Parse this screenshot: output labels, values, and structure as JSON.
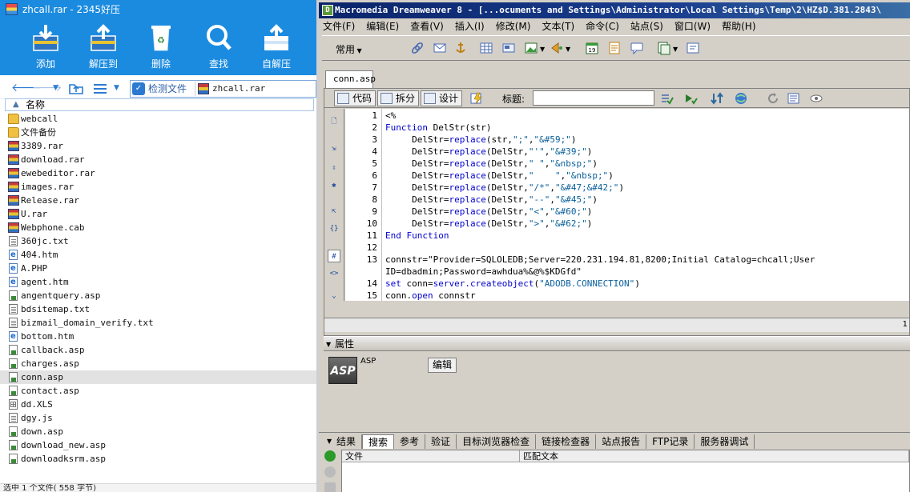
{
  "archive": {
    "title": "zhcall.rar - 2345好压",
    "toolbar": [
      "添加",
      "解压到",
      "删除",
      "查找",
      "自解压"
    ],
    "scan_label": "检测文件",
    "path": "zhcall.rar",
    "column_name": "名称",
    "files": [
      {
        "name": "webcall",
        "type": "folder"
      },
      {
        "name": "文件备份",
        "type": "folder"
      },
      {
        "name": "3389.rar",
        "type": "rar"
      },
      {
        "name": "download.rar",
        "type": "rar"
      },
      {
        "name": "ewebeditor.rar",
        "type": "rar"
      },
      {
        "name": "images.rar",
        "type": "rar"
      },
      {
        "name": "Release.rar",
        "type": "rar"
      },
      {
        "name": "U.rar",
        "type": "rar"
      },
      {
        "name": "Webphone.cab",
        "type": "cab"
      },
      {
        "name": "360jc.txt",
        "type": "txt"
      },
      {
        "name": "404.htm",
        "type": "htm"
      },
      {
        "name": "A.PHP",
        "type": "htm"
      },
      {
        "name": "agent.htm",
        "type": "htm"
      },
      {
        "name": "angentquery.asp",
        "type": "asp"
      },
      {
        "name": "bdsitemap.txt",
        "type": "txt"
      },
      {
        "name": "bizmail_domain_verify.txt",
        "type": "txt"
      },
      {
        "name": "bottom.htm",
        "type": "htm"
      },
      {
        "name": "callback.asp",
        "type": "asp"
      },
      {
        "name": "charges.asp",
        "type": "asp"
      },
      {
        "name": "conn.asp",
        "type": "asp",
        "selected": true
      },
      {
        "name": "contact.asp",
        "type": "asp"
      },
      {
        "name": "dd.XLS",
        "type": "xls"
      },
      {
        "name": "dgy.js",
        "type": "txt"
      },
      {
        "name": "down.asp",
        "type": "asp"
      },
      {
        "name": "download_new.asp",
        "type": "asp"
      },
      {
        "name": "downloadksrm.asp",
        "type": "asp"
      }
    ],
    "status": "选中 1 个文件( 558 字节)"
  },
  "dreamweaver": {
    "title": "Macromedia Dreamweaver 8 - [...ocuments and Settings\\Administrator\\Local Settings\\Temp\\2\\HZ$D.381.2843\\",
    "menu": [
      "文件(F)",
      "编辑(E)",
      "查看(V)",
      "插入(I)",
      "修改(M)",
      "文本(T)",
      "命令(C)",
      "站点(S)",
      "窗口(W)",
      "帮助(H)"
    ],
    "insert_category": "常用",
    "doc_tab": "conn.asp",
    "views": [
      "代码",
      "拆分",
      "设计"
    ],
    "title_label": "标题:",
    "code_lines": [
      {
        "n": "1",
        "text": "<%"
      },
      {
        "n": "2",
        "text": "Function DelStr(str)"
      },
      {
        "n": "3",
        "text": "     DelStr=replace(str,\";\",\"&#59;\")"
      },
      {
        "n": "4",
        "text": "     DelStr=replace(DelStr,\"'\",\"&#39;\")"
      },
      {
        "n": "5",
        "text": "     DelStr=replace(DelStr,\" \",\"&nbsp;\")"
      },
      {
        "n": "6",
        "text": "     DelStr=replace(DelStr,\"    \",\"&nbsp;\")"
      },
      {
        "n": "7",
        "text": "     DelStr=replace(DelStr,\"/*\",\"&#47;&#42;\")"
      },
      {
        "n": "8",
        "text": "     DelStr=replace(DelStr,\"--\",\"&#45;\")"
      },
      {
        "n": "9",
        "text": "     DelStr=replace(DelStr,\"<\",\"&#60;\")"
      },
      {
        "n": "10",
        "text": "     DelStr=replace(DelStr,\">\",\"&#62;\")"
      },
      {
        "n": "11",
        "text": "End Function"
      },
      {
        "n": "12",
        "text": ""
      },
      {
        "n": "13",
        "text": "connstr=\"Provider=SQLOLEDB;Server=220.231.194.81,8200;Initial Catalog=chcall;User"
      },
      {
        "n": "",
        "text": "ID=dbadmin;Password=awhdua%&@%$KDGfd\""
      },
      {
        "n": "14",
        "text": "set conn=server.createobject(\"ADODB.CONNECTION\")"
      },
      {
        "n": "15",
        "text": "conn.open connstr"
      }
    ],
    "hscroll_value": "1",
    "properties_label": "属性",
    "file_type": "ASP",
    "edit_button": "编辑",
    "result_tabs": [
      "结果",
      "搜索",
      "参考",
      "验证",
      "目标浏览器检查",
      "链接检查器",
      "站点报告",
      "FTP记录",
      "服务器调试"
    ],
    "result_columns": [
      "文件",
      "匹配文本"
    ]
  }
}
